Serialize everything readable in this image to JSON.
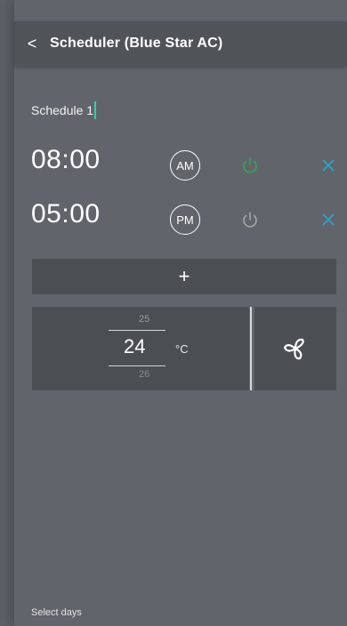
{
  "header": {
    "back_icon": "chevron-left-icon",
    "title": "Scheduler (Blue Star AC)"
  },
  "schedule": {
    "name": "Schedule 1"
  },
  "entries": [
    {
      "time": "08:00",
      "period": "AM",
      "power_icon": "power-icon",
      "power_color": "#3aa35a",
      "delete_icon": "close-icon",
      "delete_color": "#2aa6c9"
    },
    {
      "time": "05:00",
      "period": "PM",
      "power_icon": "power-icon",
      "power_color": "#a8aaa8",
      "delete_icon": "close-icon",
      "delete_color": "#2aa6c9"
    }
  ],
  "add_button": {
    "label": "+"
  },
  "temperature": {
    "prev": "25",
    "current": "24",
    "next": "26",
    "unit": "°C"
  },
  "mode": {
    "icon": "fan-icon"
  },
  "footer": {
    "select_days_label": "Select days"
  },
  "colors": {
    "accent": "#2fcfb0",
    "panel": "#4b4f54",
    "background": "#61656b"
  }
}
